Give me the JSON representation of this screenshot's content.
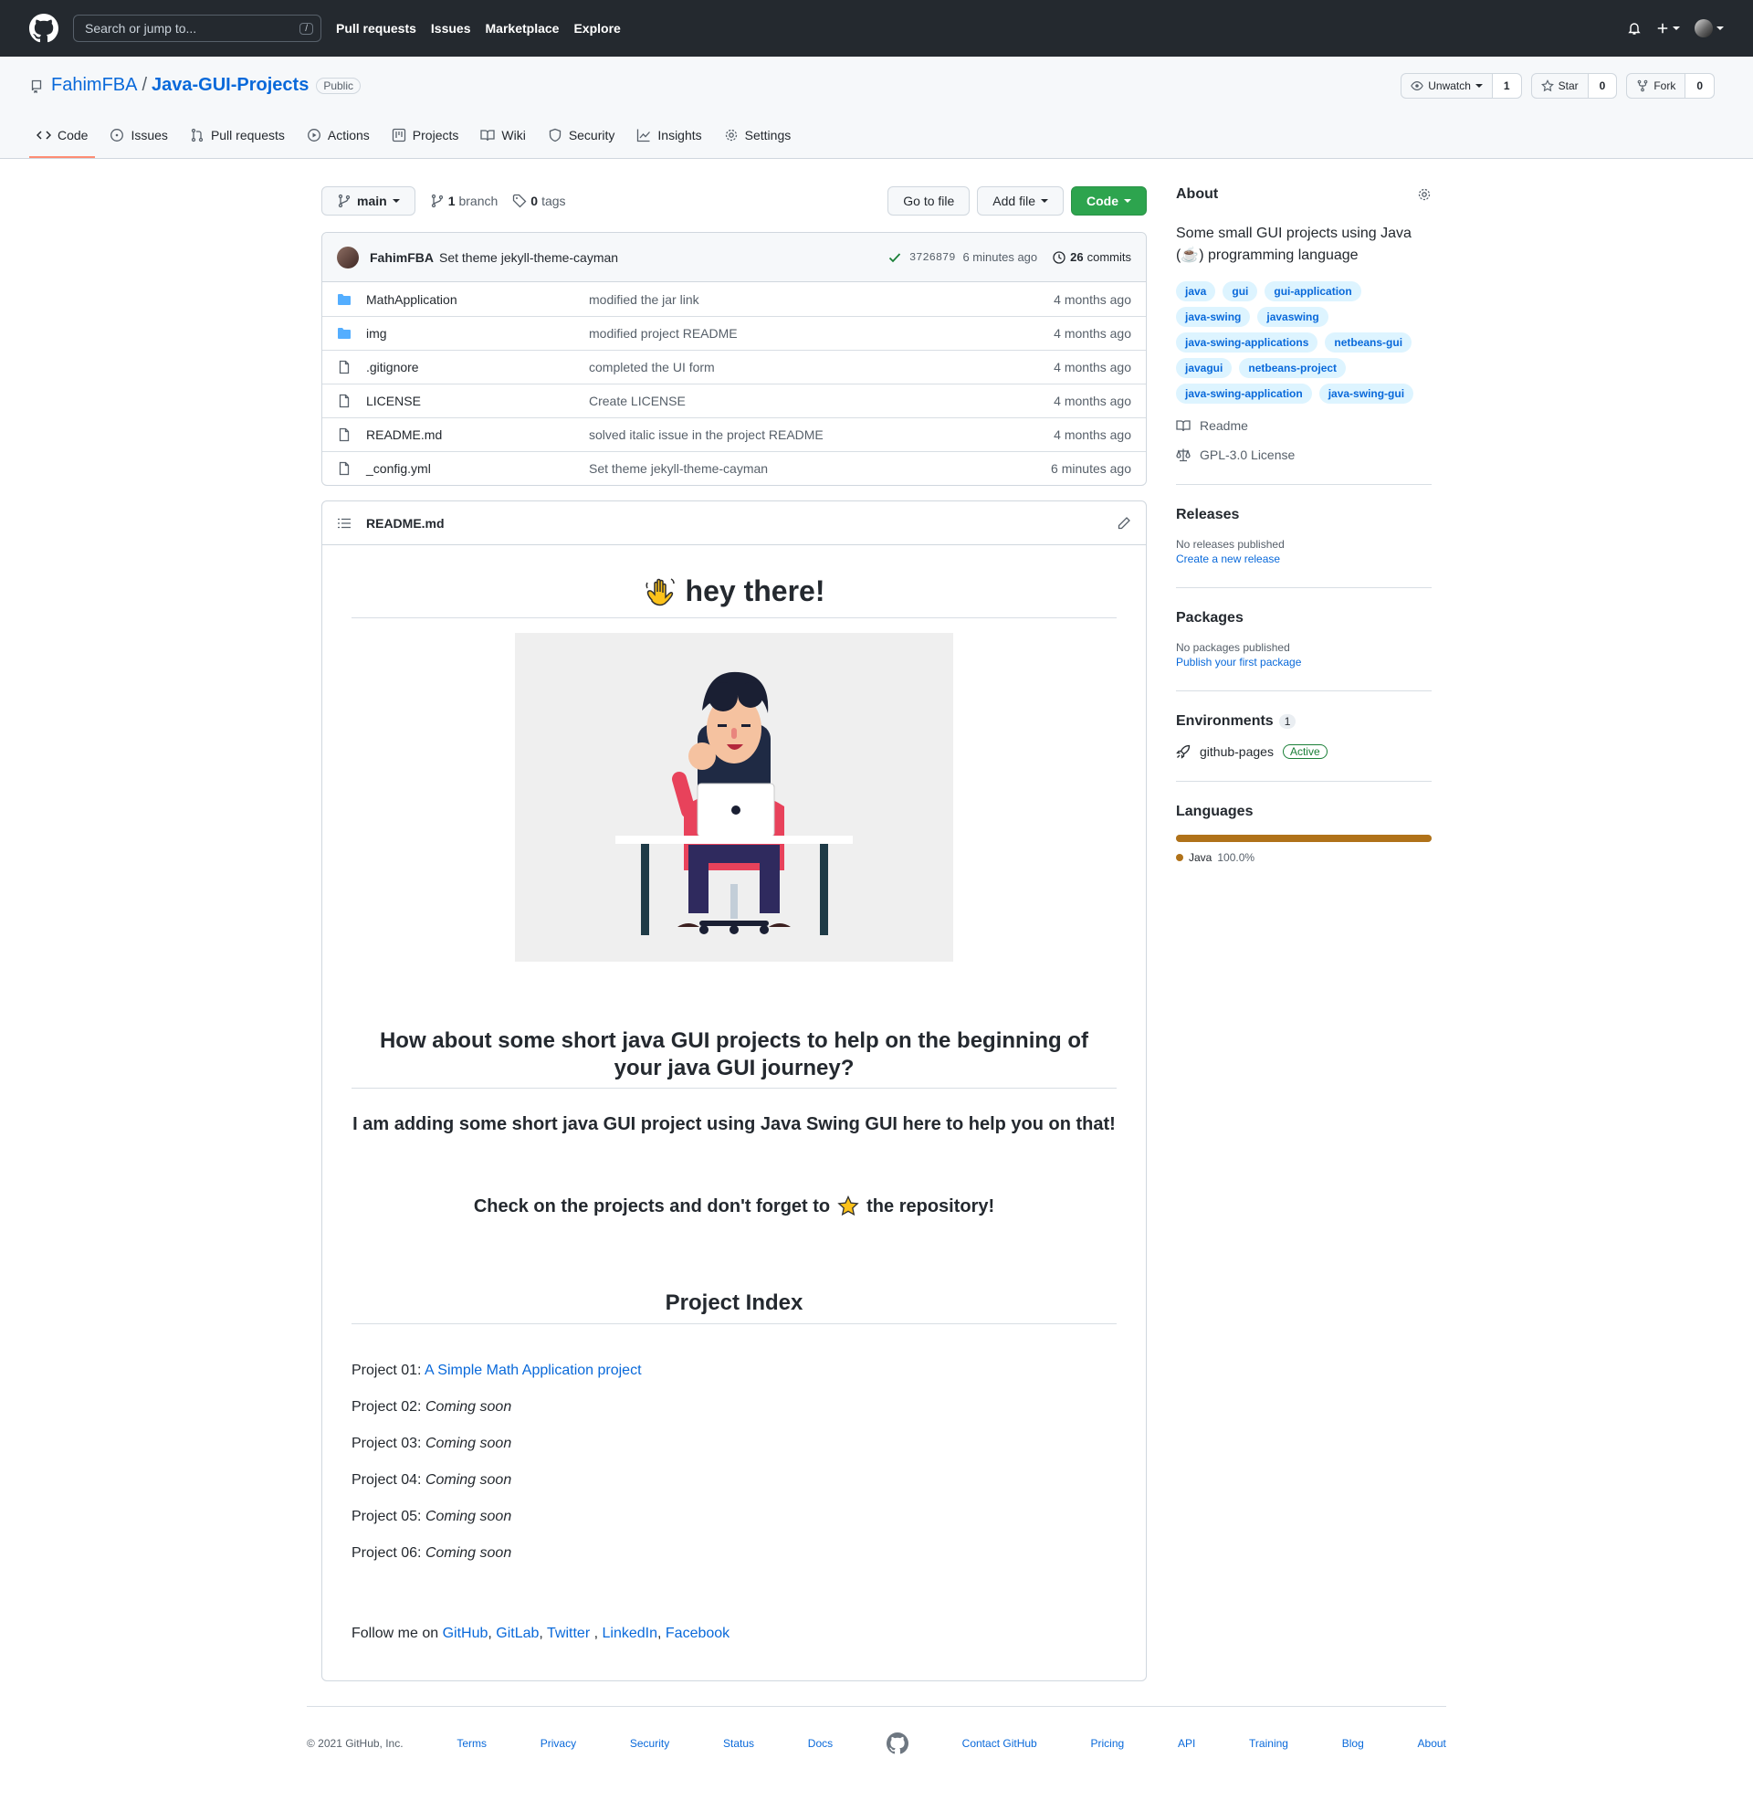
{
  "header": {
    "search_placeholder": "Search or jump to...",
    "slash": "/",
    "nav": [
      "Pull requests",
      "Issues",
      "Marketplace",
      "Explore"
    ]
  },
  "repo": {
    "owner": "FahimFBA",
    "separator": "/",
    "name": "Java-GUI-Projects",
    "visibility": "Public",
    "unwatch_label": "Unwatch",
    "watch_count": "1",
    "star_label": "Star",
    "star_count": "0",
    "fork_label": "Fork",
    "fork_count": "0"
  },
  "tabs": [
    "Code",
    "Issues",
    "Pull requests",
    "Actions",
    "Projects",
    "Wiki",
    "Security",
    "Insights",
    "Settings"
  ],
  "filenav": {
    "branch": "main",
    "branches_count": "1",
    "branches_label": "branch",
    "tags_count": "0",
    "tags_label": "tags",
    "go_to_file": "Go to file",
    "add_file": "Add file",
    "code": "Code"
  },
  "commit": {
    "author": "FahimFBA",
    "message": "Set theme jekyll-theme-cayman",
    "sha": "3726879",
    "age": "6 minutes ago",
    "commits_count": "26",
    "commits_label": "commits"
  },
  "files": [
    {
      "type": "dir",
      "name": "MathApplication",
      "message": "modified the jar link",
      "age": "4 months ago"
    },
    {
      "type": "dir",
      "name": "img",
      "message": "modified project README",
      "age": "4 months ago"
    },
    {
      "type": "file",
      "name": ".gitignore",
      "message": "completed the UI form",
      "age": "4 months ago"
    },
    {
      "type": "file",
      "name": "LICENSE",
      "message": "Create LICENSE",
      "age": "4 months ago"
    },
    {
      "type": "file",
      "name": "README.md",
      "message": "solved italic issue in the project README",
      "age": "4 months ago"
    },
    {
      "type": "file",
      "name": "_config.yml",
      "message": "Set theme jekyll-theme-cayman",
      "age": "6 minutes ago"
    }
  ],
  "readme": {
    "filename": "README.md",
    "h1": "hey there!",
    "h2": "How about some short java GUI projects to help on the beginning of your java GUI journey?",
    "h3": "I am adding some short java GUI project using Java Swing GUI here to help you on that!",
    "star_text_before": "Check on the projects and don't forget to",
    "star_text_after": "the repository!",
    "index_title": "Project Index",
    "projects": [
      {
        "label": "Project 01: ",
        "text": "A Simple Math Application project",
        "link": true
      },
      {
        "label": "Project 02: ",
        "text": "Coming soon",
        "link": false
      },
      {
        "label": "Project 03: ",
        "text": "Coming soon",
        "link": false
      },
      {
        "label": "Project 04: ",
        "text": "Coming soon",
        "link": false
      },
      {
        "label": "Project 05: ",
        "text": "Coming soon",
        "link": false
      },
      {
        "label": "Project 06: ",
        "text": "Coming soon",
        "link": false
      }
    ],
    "follow_prefix": "Follow me on ",
    "follow_links": [
      "GitHub",
      "GitLab",
      "Twitter",
      "LinkedIn",
      "Facebook"
    ]
  },
  "sidebar": {
    "about_title": "About",
    "description": "Some small GUI projects using Java (☕) programming language",
    "topics": [
      "java",
      "gui",
      "gui-application",
      "java-swing",
      "javaswing",
      "java-swing-applications",
      "netbeans-gui",
      "javagui",
      "netbeans-project",
      "java-swing-application",
      "java-swing-gui"
    ],
    "readme_link": "Readme",
    "license_link": "GPL-3.0 License",
    "releases_title": "Releases",
    "releases_none": "No releases published",
    "releases_create": "Create a new release",
    "packages_title": "Packages",
    "packages_none": "No packages published",
    "packages_publish": "Publish your first package",
    "environments_title": "Environments",
    "environments_count": "1",
    "env_name": "github-pages",
    "env_status": "Active",
    "languages_title": "Languages",
    "language_name": "Java",
    "language_pct": "100.0%",
    "language_share": 1.0,
    "language_color": "#b07219"
  },
  "footer": {
    "copyright": "© 2021 GitHub, Inc.",
    "left_links": [
      "Terms",
      "Privacy",
      "Security",
      "Status",
      "Docs"
    ],
    "right_links": [
      "Contact GitHub",
      "Pricing",
      "API",
      "Training",
      "Blog",
      "About"
    ]
  },
  "colors": {
    "header_bg": "#24292f",
    "accent_link": "#0969da",
    "code_button": "#2da44e",
    "active_tab_underline": "#fd8c73"
  }
}
